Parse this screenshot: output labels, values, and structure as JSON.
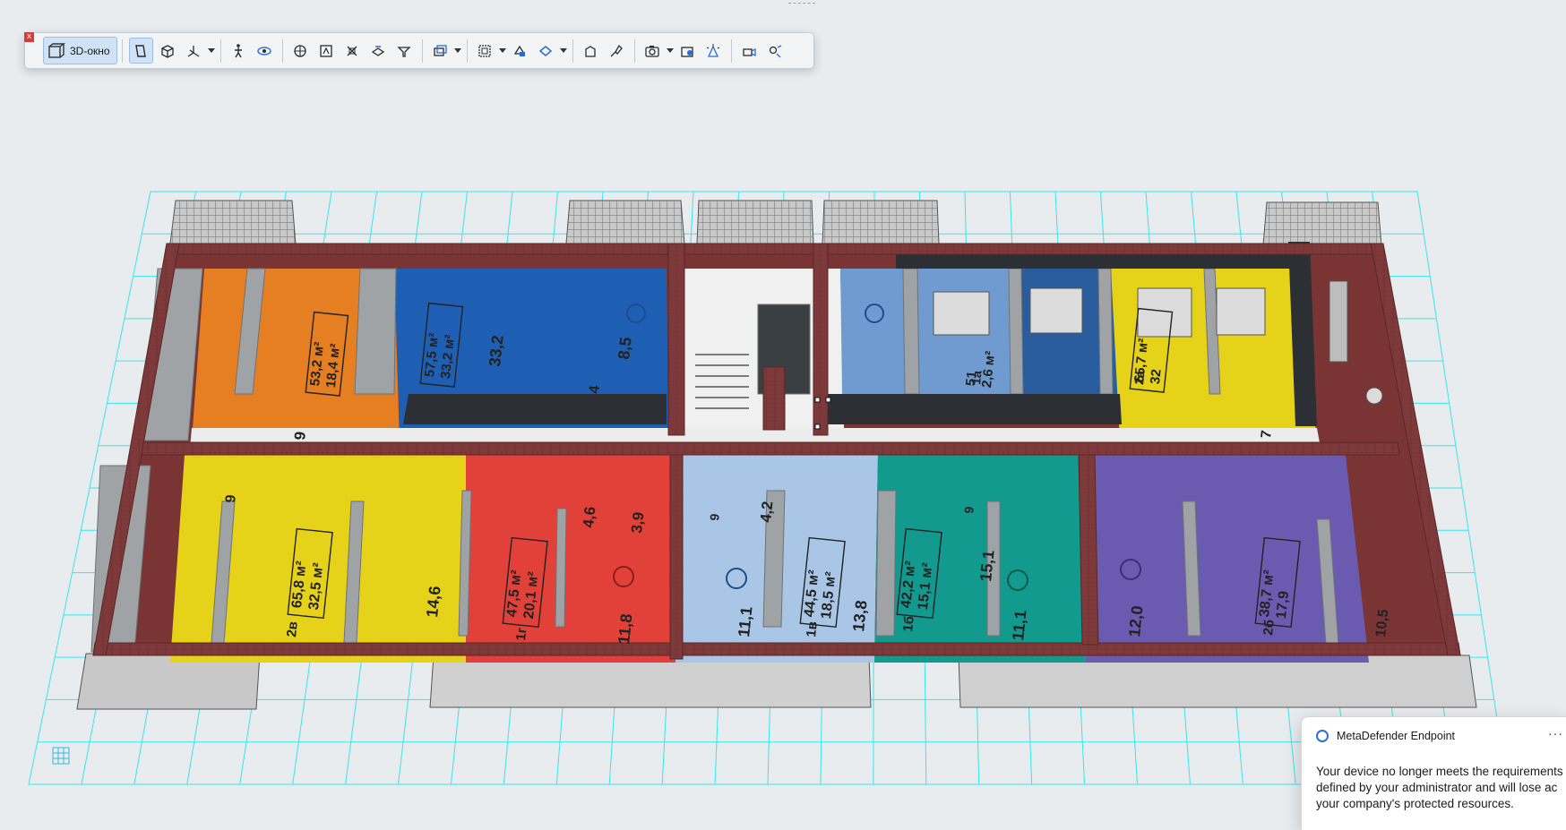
{
  "toolbar": {
    "close_label": "x",
    "title_label": "3D-окно",
    "buttons": [
      {
        "name": "generic-mode-icon",
        "active": true
      },
      {
        "name": "axonometry-icon"
      },
      {
        "name": "orbit-icon",
        "dropdown": true
      },
      {
        "name": "walk-icon"
      },
      {
        "name": "explore-icon"
      },
      {
        "name": "zoom-extents-icon"
      },
      {
        "name": "fit-window-icon"
      },
      {
        "name": "section-icon"
      },
      {
        "name": "cutaway-icon"
      },
      {
        "name": "filter-icon"
      },
      {
        "name": "layer-combination-icon",
        "dropdown": true
      },
      {
        "name": "view-frame-icon",
        "dropdown": true
      },
      {
        "name": "shading-icon"
      },
      {
        "name": "surface-icon",
        "dropdown": true
      },
      {
        "name": "material-icon"
      },
      {
        "name": "paint-icon"
      },
      {
        "name": "camera-icon",
        "dropdown": true
      },
      {
        "name": "render-icon"
      },
      {
        "name": "light-icon"
      },
      {
        "name": "project-camera-icon"
      },
      {
        "name": "settings-3d-icon"
      }
    ]
  },
  "rooms": {
    "orange_top": [
      "53,2 м²",
      "18,4 м²",
      "9"
    ],
    "blue_top_left": [
      "57,5 м²",
      "33,2 м²",
      "33,2",
      "8,5",
      "4"
    ],
    "blue_top_right": [
      "51",
      "2,6 м²",
      "1а"
    ],
    "yellow_top_right": [
      "65,7 м²",
      "32",
      "2а",
      "7"
    ],
    "yellow_bottom_left": [
      "65,8 м²",
      "32,5 м²",
      "2в",
      "14,6",
      "9"
    ],
    "red": [
      "47,5 м²",
      "20,1 м²",
      "1г",
      "4,6",
      "3,9",
      "11,8"
    ],
    "light_blue": [
      "44,5 м²",
      "18,5 м²",
      "1в",
      "4,2",
      "11,1",
      "13,8",
      "9"
    ],
    "teal": [
      "42,2 м²",
      "15,1 м²",
      "1б",
      "15,1",
      "11,1",
      "9"
    ],
    "purple": [
      "38,7 м²",
      "17,9",
      "2б",
      "12,0",
      "10,5"
    ]
  },
  "toast": {
    "app": "MetaDefender Endpoint",
    "more": "···",
    "line1": "Your device no longer meets the requirements",
    "line2": "defined by your administrator and will lose ac",
    "line3": "your company's protected resources."
  },
  "colors": {
    "background": "#e8ecee",
    "grid": "#36e6ef",
    "brick": "#7a3636",
    "orange": "#e67e22",
    "blue": "#1f5fb3",
    "yellow": "#e7d21a",
    "red": "#e2413a",
    "light_blue": "#a9c6e6",
    "teal": "#139a8f",
    "purple": "#6b5bb0",
    "toolbar_active": "#cfe2f6"
  }
}
